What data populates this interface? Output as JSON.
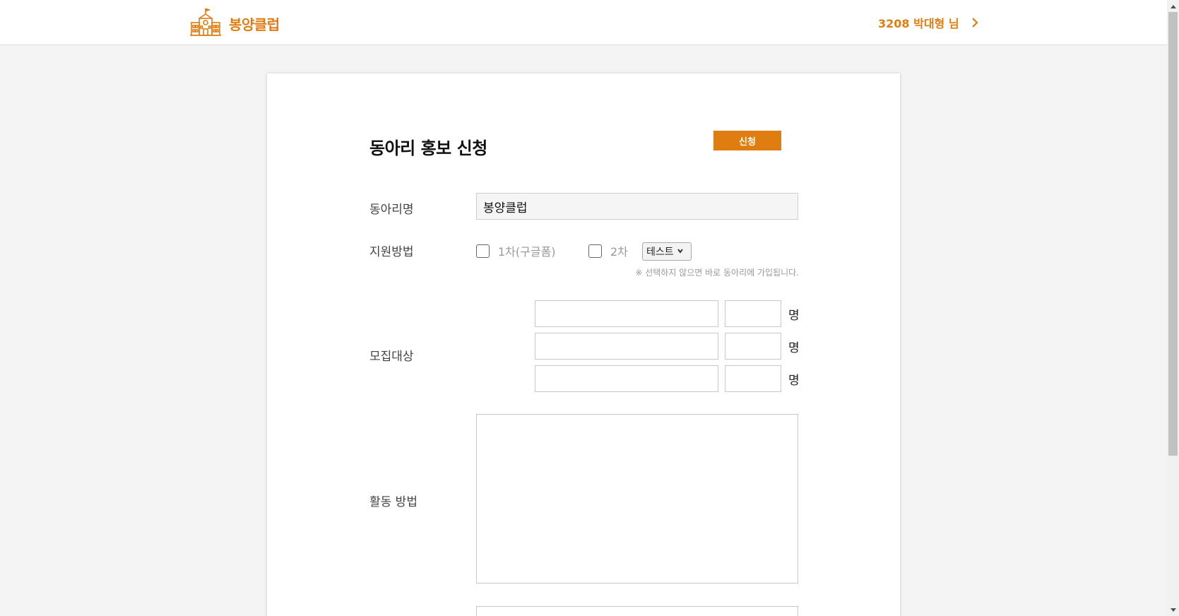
{
  "header": {
    "logo_text": "봉양클럽",
    "logo_icon": "school-building-icon",
    "user_label": "3208 박대형 님",
    "user_chevron_icon": "chevron-right-icon"
  },
  "colors": {
    "accent": "#e07d10",
    "page_bg": "#f4f4f4"
  },
  "form": {
    "title": "동아리 홍보 신청",
    "submit_label": "신청",
    "club_name": {
      "label": "동아리명",
      "value": "봉양클럽"
    },
    "apply_method": {
      "label": "지원방법",
      "option1": "1차(구글폼)",
      "option2": "2차",
      "select_value": "테스트",
      "notice": "※ 선택하지 않으면 바로 동아리에 가입됩니다."
    },
    "recruit": {
      "label": "모집대상",
      "rows": [
        {
          "target": "",
          "count": "",
          "unit": "명"
        },
        {
          "target": "",
          "count": "",
          "unit": "명"
        },
        {
          "target": "",
          "count": "",
          "unit": "명"
        }
      ]
    },
    "activity": {
      "label": "활동 방법",
      "value": ""
    }
  }
}
